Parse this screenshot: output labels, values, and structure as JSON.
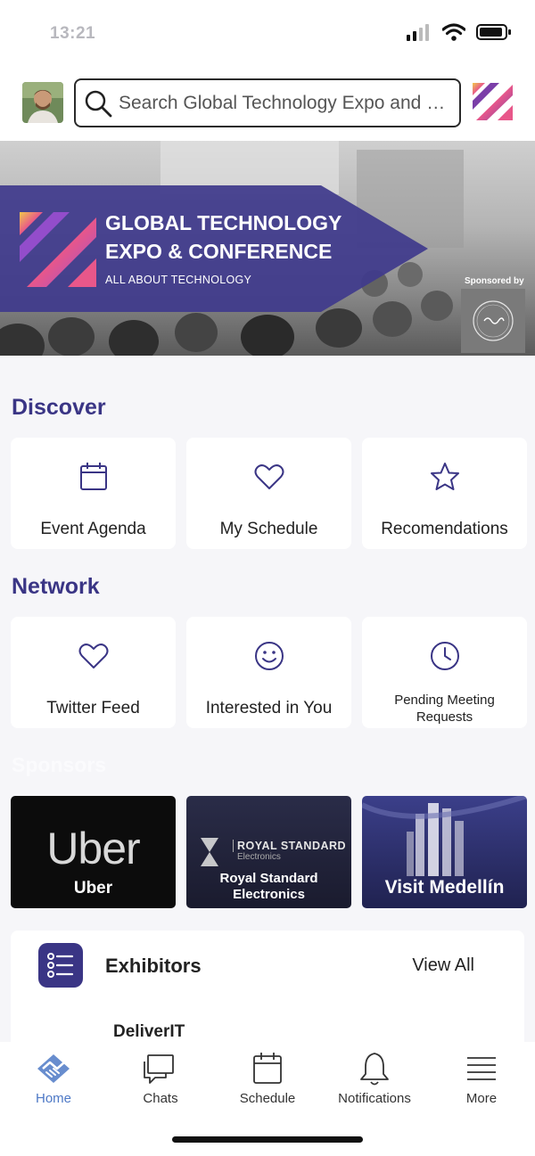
{
  "status_bar": {
    "time": "13:21"
  },
  "search": {
    "placeholder": "Search Global Technology Expo and Co..."
  },
  "banner": {
    "title_line1": "GLOBAL TECHNOLOGY",
    "title_line2": "EXPO & CONFERENCE",
    "tagline": "ALL ABOUT TECHNOLOGY",
    "sponsored_by": "Sponsored by"
  },
  "discover": {
    "title": "Discover",
    "items": [
      {
        "label": "Event Agenda",
        "icon": "calendar-icon"
      },
      {
        "label": "My Schedule",
        "icon": "heart-icon"
      },
      {
        "label": "Recomendations",
        "icon": "star-icon"
      }
    ]
  },
  "network": {
    "title": "Network",
    "items": [
      {
        "label": "Twitter Feed",
        "icon": "heart-icon"
      },
      {
        "label": "Interested in You",
        "icon": "smiley-icon"
      },
      {
        "label": "Pending Meeting Requests",
        "icon": "clock-icon"
      }
    ]
  },
  "sponsors": {
    "title": "Sponsors",
    "items": [
      {
        "label": "Uber",
        "logo_text": "Uber"
      },
      {
        "label": "Royal Standard Electronics",
        "logo_text": "ROYAL STANDARD",
        "logo_sub": "Electronics"
      },
      {
        "label": "Visit Medellín"
      }
    ]
  },
  "exhibitors": {
    "title": "Exhibitors",
    "view_all": "View All",
    "first_item": "DeliverIT"
  },
  "tabbar": {
    "items": [
      {
        "label": "Home",
        "icon": "handshake-icon",
        "active": true
      },
      {
        "label": "Chats",
        "icon": "chat-icon"
      },
      {
        "label": "Schedule",
        "icon": "calendar-icon"
      },
      {
        "label": "Notifications",
        "icon": "bell-icon"
      },
      {
        "label": "More",
        "icon": "menu-icon"
      }
    ]
  },
  "colors": {
    "accent": "#3a3585",
    "active_tab": "#4e79c6",
    "banner_arrow": "#3f3a8c"
  }
}
